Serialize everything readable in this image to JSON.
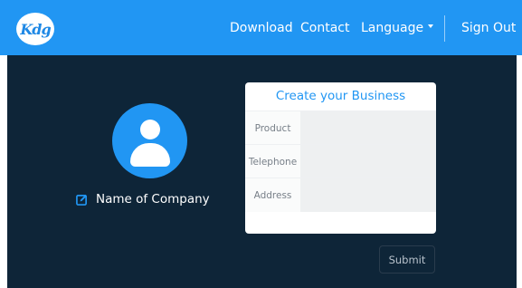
{
  "navbar": {
    "logo_text": "Kdg",
    "links": {
      "download": "Download",
      "contact": "Contact",
      "language": "Language",
      "sign_out": "Sign Out"
    },
    "colors": {
      "background": "#2196f3",
      "text": "#ffffff"
    }
  },
  "profile": {
    "company_name": "Name of Company",
    "avatar_icon": "user-icon",
    "edit_icon": "edit-icon",
    "colors": {
      "avatar": "#2196f3"
    }
  },
  "form": {
    "title": "Create your Business",
    "fields": {
      "product": {
        "label": "Product",
        "value": ""
      },
      "telephone": {
        "label": "Telephone",
        "value": ""
      },
      "address": {
        "label": "Address",
        "value": ""
      }
    },
    "submit_label": "Submit"
  },
  "colors": {
    "page_background": "#0e2538",
    "accent": "#2196f3"
  }
}
